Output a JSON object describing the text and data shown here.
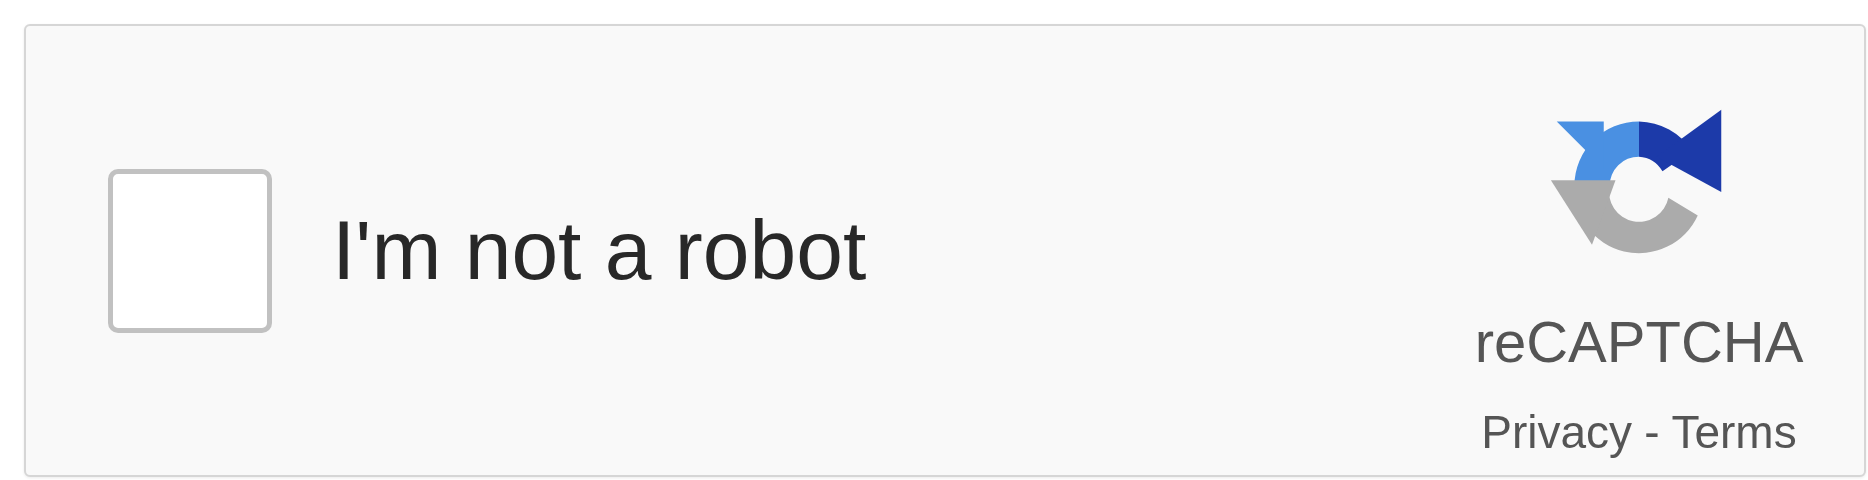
{
  "checkbox": {
    "label": "I'm not a robot",
    "checked": false
  },
  "brand": {
    "name": "reCAPTCHA"
  },
  "links": [
    {
      "label": "Privacy"
    },
    {
      "label": "Terms"
    }
  ],
  "link_separator": "-"
}
